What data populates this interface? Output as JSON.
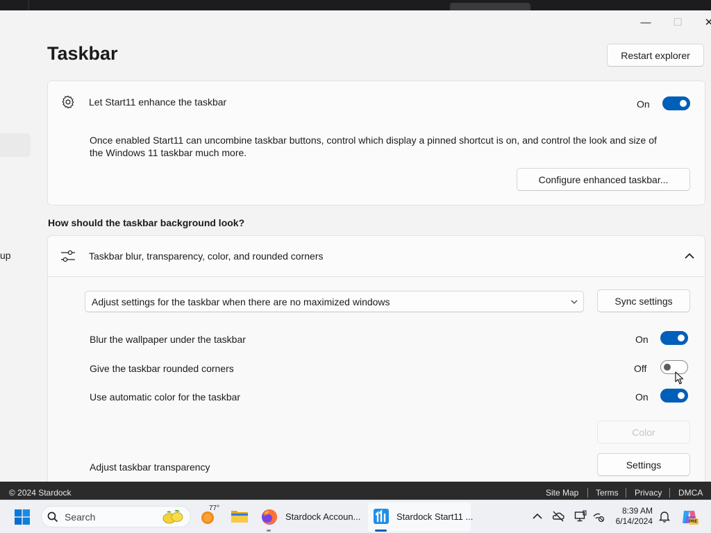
{
  "window": {
    "title": "Taskbar",
    "restart_button": "Restart explorer",
    "minimize_glyph": "—",
    "maximize_glyph": "☐",
    "close_glyph": "✕"
  },
  "sidebar": {
    "partial_label": "up"
  },
  "enhance_card": {
    "label": "Let Start11 enhance the taskbar",
    "state": "On",
    "description_line1": "Once enabled Start11 can uncombine taskbar buttons, control which display a pinned shortcut is on, and control the look and size of",
    "description_line2": "the Windows 11 taskbar much more.",
    "configure_button": "Configure enhanced taskbar..."
  },
  "background_section": {
    "heading": "How should the taskbar background look?",
    "expander_label": "Taskbar blur, transparency, color, and rounded corners",
    "dropdown_value": "Adjust settings for the taskbar when there are no maximized windows",
    "sync_button": "Sync settings",
    "settings": [
      {
        "label": "Blur the wallpaper under the taskbar",
        "state": "On",
        "on": true
      },
      {
        "label": "Give the taskbar rounded corners",
        "state": "Off",
        "on": false
      },
      {
        "label": "Use automatic color for the taskbar",
        "state": "On",
        "on": true
      }
    ],
    "color_button": "Color",
    "transparency_label": "Adjust taskbar transparency",
    "transparency_button": "Settings"
  },
  "footer": {
    "copyright": "© 2024 Stardock",
    "links": [
      "Site Map",
      "Terms",
      "Privacy",
      "DMCA"
    ]
  },
  "taskbar": {
    "search_placeholder": "Search",
    "weather_temp": "77°",
    "apps": [
      {
        "label": "Stardock Accoun...",
        "icon": "firefox-icon"
      },
      {
        "label": "Stardock Start11 ...",
        "icon": "start11-icon"
      }
    ],
    "time": "8:39 AM",
    "date": "6/14/2024",
    "accent": "#005fb8"
  }
}
